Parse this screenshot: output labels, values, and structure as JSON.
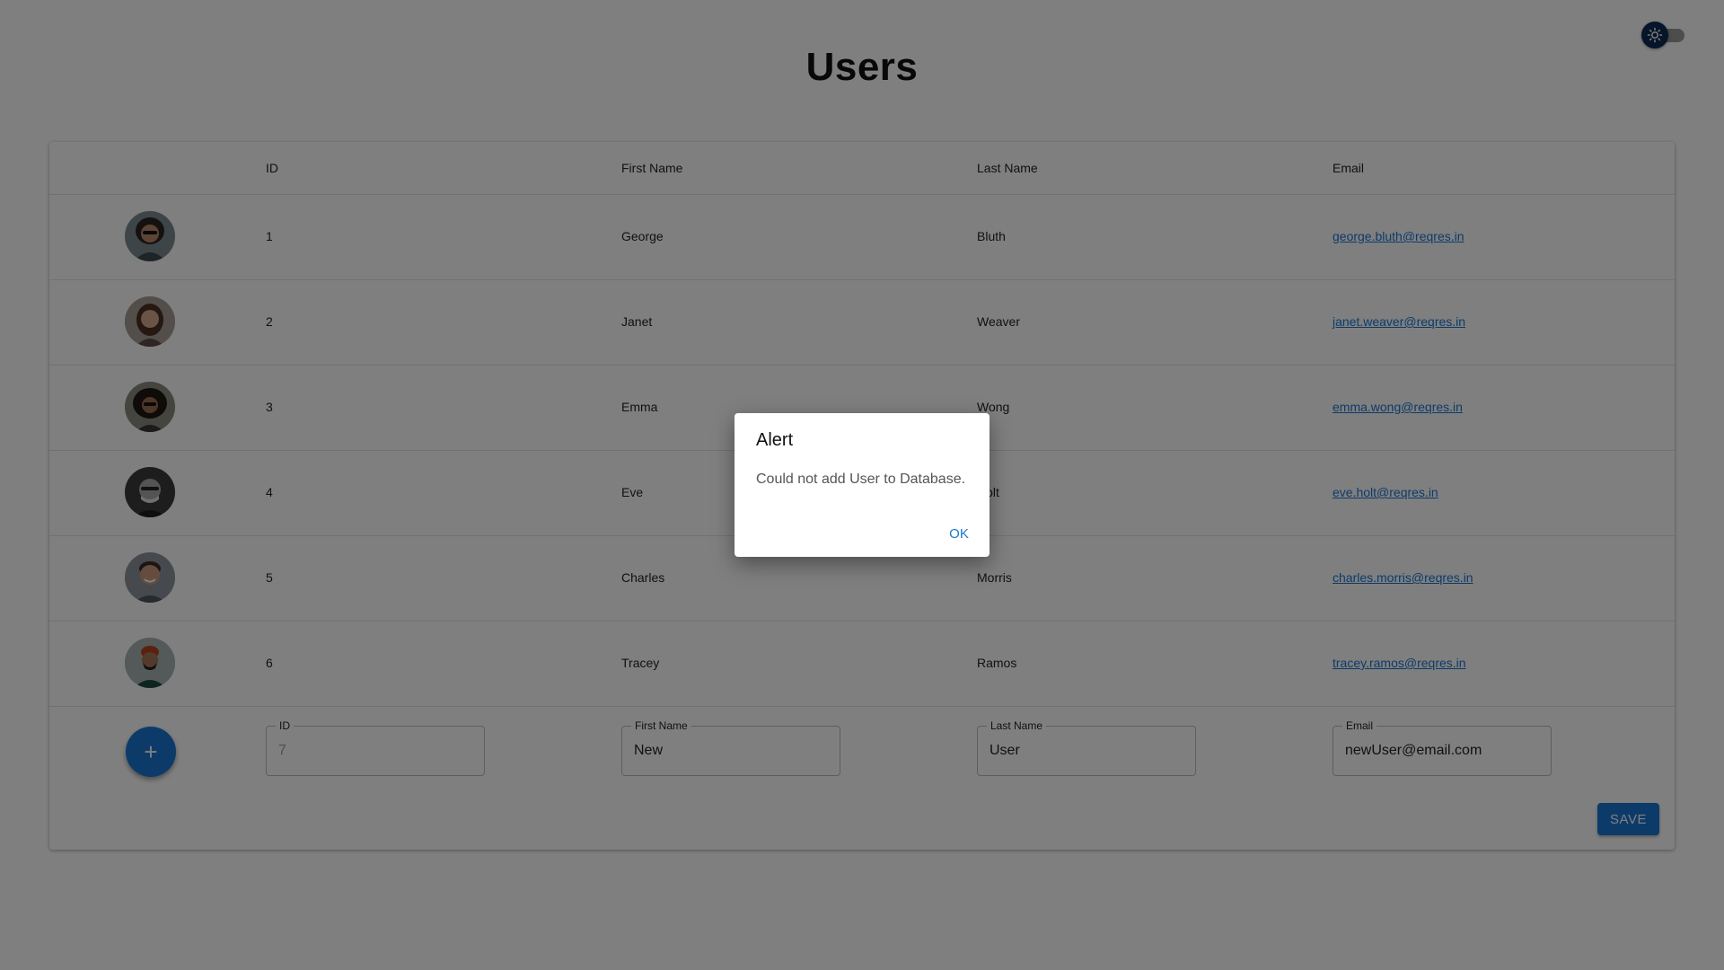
{
  "page": {
    "title": "Users"
  },
  "theme_toggle": {
    "icon": "sun-icon",
    "state": "dark"
  },
  "table": {
    "headers": {
      "id": "ID",
      "first_name": "First Name",
      "last_name": "Last Name",
      "email": "Email"
    },
    "rows": [
      {
        "id": "1",
        "first_name": "George",
        "last_name": "Bluth",
        "email": "george.bluth@reqres.in"
      },
      {
        "id": "2",
        "first_name": "Janet",
        "last_name": "Weaver",
        "email": "janet.weaver@reqres.in"
      },
      {
        "id": "3",
        "first_name": "Emma",
        "last_name": "Wong",
        "email": "emma.wong@reqres.in"
      },
      {
        "id": "4",
        "first_name": "Eve",
        "last_name": "Holt",
        "email": "eve.holt@reqres.in"
      },
      {
        "id": "5",
        "first_name": "Charles",
        "last_name": "Morris",
        "email": "charles.morris@reqres.in"
      },
      {
        "id": "6",
        "first_name": "Tracey",
        "last_name": "Ramos",
        "email": "tracey.ramos@reqres.in"
      }
    ]
  },
  "new_user_form": {
    "add_icon": "+",
    "id_label": "ID",
    "id_placeholder": "7",
    "first_name_label": "First Name",
    "first_name_value": "New",
    "last_name_label": "Last Name",
    "last_name_value": "User",
    "email_label": "Email",
    "email_value": "newUser@email.com",
    "save_label": "SAVE"
  },
  "alert_dialog": {
    "title": "Alert",
    "message": "Could not add User to Database.",
    "ok_label": "OK"
  },
  "colors": {
    "accent": "#1976d2",
    "toggle_thumb": "#0d2a52",
    "overlay": "rgba(0,0,0,0.5)"
  }
}
